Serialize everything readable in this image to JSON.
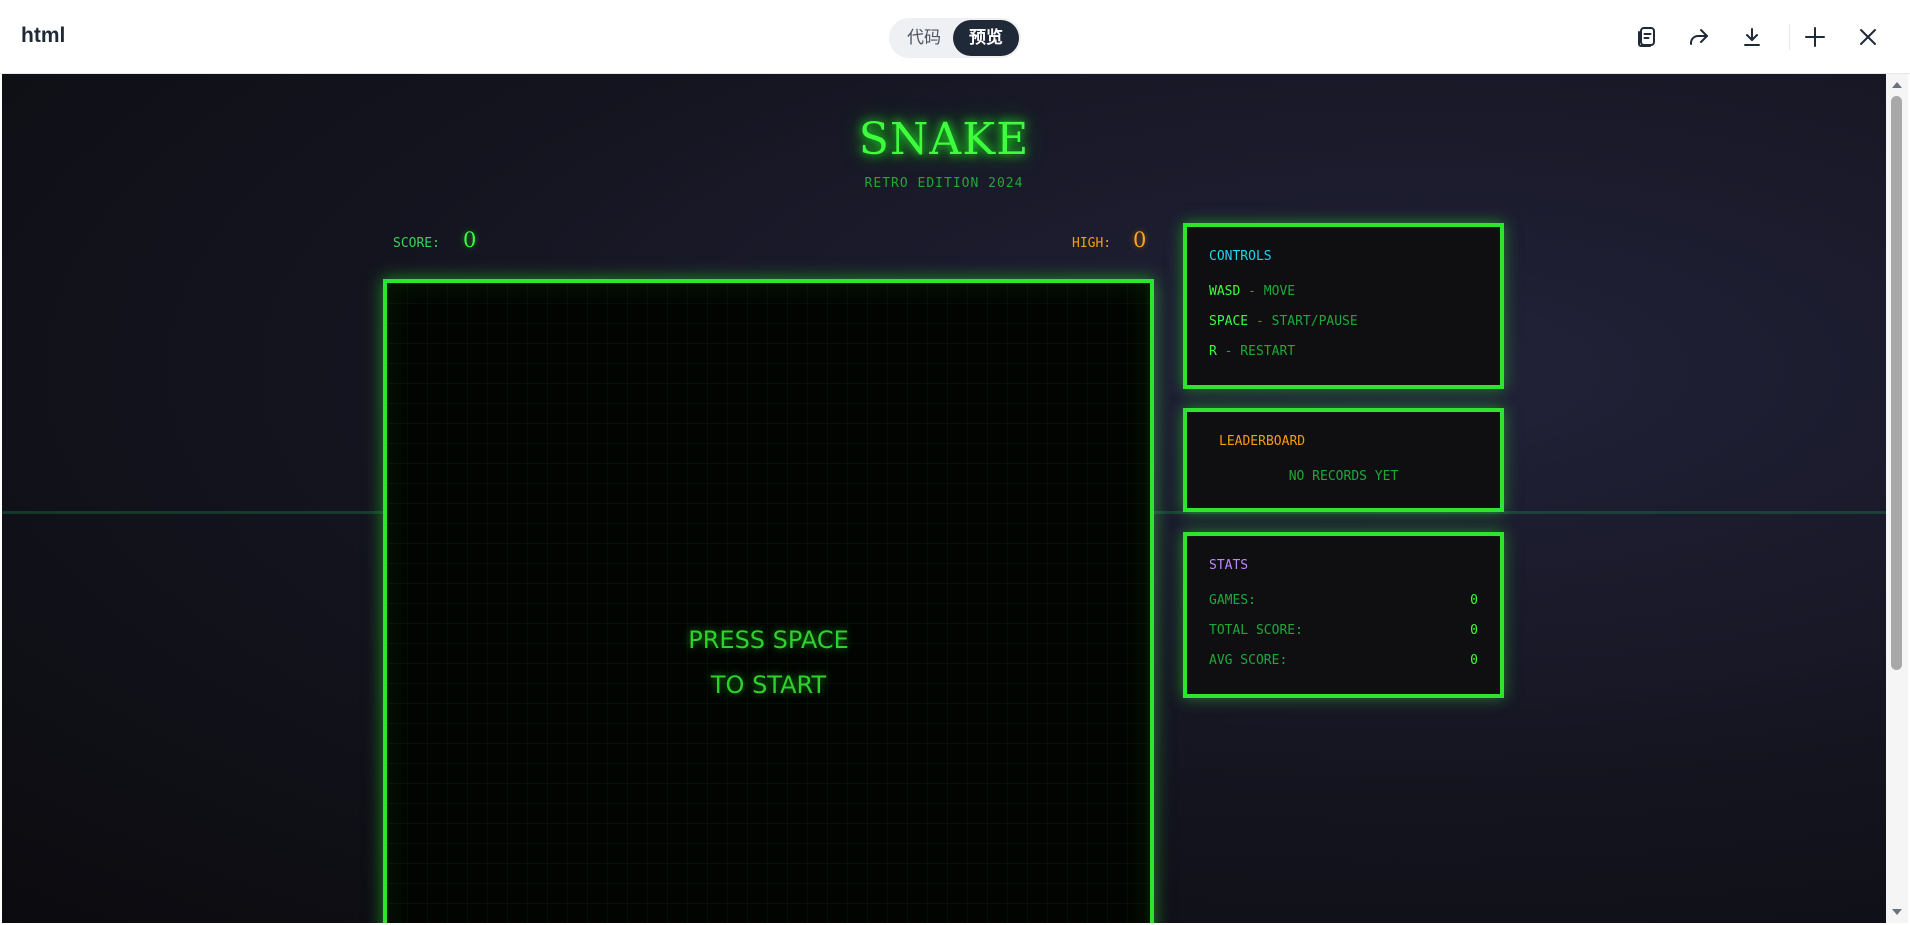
{
  "window": {
    "title": "html"
  },
  "view_toggle": {
    "code_label": "代码",
    "preview_label": "预览",
    "selected": "预览"
  },
  "toolbar": {
    "icons": [
      "copy-icon",
      "share-icon",
      "download-icon",
      "collapse-icon",
      "close-icon"
    ]
  },
  "game": {
    "title": "SNAKE",
    "subtitle": "RETRO EDITION 2024",
    "score_label": "SCORE:",
    "score_value": "0",
    "high_label": "HIGH:",
    "high_value": "0",
    "overlay_line1": "PRESS SPACE",
    "overlay_line2": "TO START"
  },
  "controls": {
    "heading": "CONTROLS",
    "items": [
      {
        "key": "WASD",
        "desc": " - MOVE"
      },
      {
        "key": "SPACE",
        "desc": " - START/PAUSE"
      },
      {
        "key": "R",
        "desc": " - RESTART"
      }
    ]
  },
  "leaderboard": {
    "heading": "LEADERBOARD",
    "empty_text": "NO RECORDS YET"
  },
  "stats": {
    "heading": "STATS",
    "rows": [
      {
        "label": "GAMES:",
        "value": "0"
      },
      {
        "label": "TOTAL SCORE:",
        "value": "0"
      },
      {
        "label": "AVG SCORE:",
        "value": "0"
      }
    ]
  },
  "colors": {
    "neon_green": "#2ee42e",
    "orange": "#f59e0b",
    "cyan": "#22d3ee",
    "purple": "#c084fc",
    "background": "#14141f"
  }
}
